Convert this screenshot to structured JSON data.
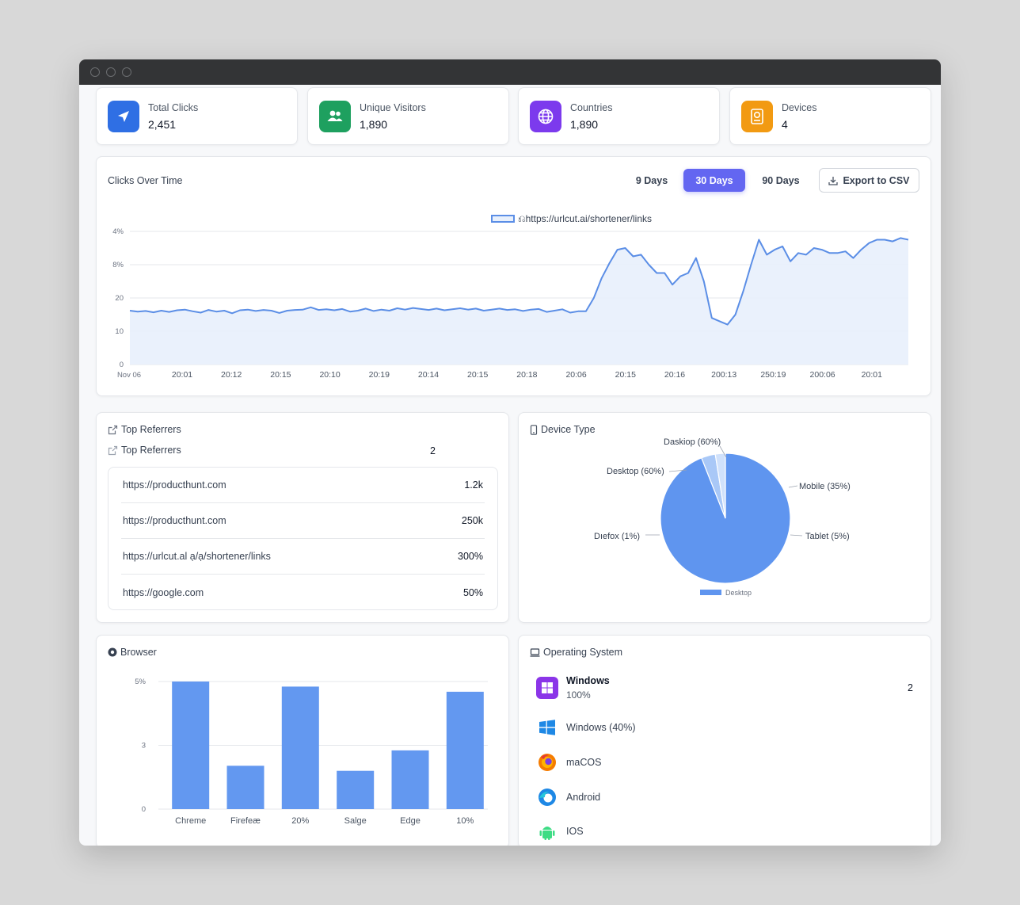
{
  "stats": [
    {
      "label": "Total Clicks",
      "value": "2,451",
      "icon": "send-icon",
      "color": "#2f6fe4"
    },
    {
      "label": "Unique Visitors",
      "value": "1,890",
      "icon": "users-icon",
      "color": "#1ea05f"
    },
    {
      "label": "Countries",
      "value": "1,890",
      "icon": "globe-icon",
      "color": "#7c3aed"
    },
    {
      "label": "Devices",
      "value": "4",
      "icon": "device-icon",
      "color": "#f29a12"
    }
  ],
  "clicks_chart": {
    "title": "Clicks Over Time",
    "ranges": [
      "9 Days",
      "30 Days",
      "90 Days"
    ],
    "active_range": "30 Days",
    "export_label": "Export to CSV",
    "legend": "⎌https://urlcut.ai/shortener/links",
    "accent": "#6366f1",
    "line_color": "#5b8ee6",
    "fill_color": "#e8f0fc"
  },
  "referrers": {
    "heading": "Top Referrers",
    "subheading": "Top Referrers",
    "count": "2",
    "rows": [
      {
        "url": "https://producthunt.com",
        "value": "1.2k"
      },
      {
        "url": "https://producthunt.com",
        "value": "250k"
      },
      {
        "url": "https://urlcut.al ạ/ạ/shortener/links",
        "value": "300%"
      },
      {
        "url": "https://google.com",
        "value": "50%"
      }
    ]
  },
  "device_type": {
    "title": "Device Type",
    "legend": "Desktop"
  },
  "browser": {
    "title": "Browser"
  },
  "os": {
    "title": "Operating System",
    "count": "2",
    "items": [
      {
        "label": "Windows",
        "sub": "100%",
        "icon": "windows-app-icon"
      },
      {
        "label": "Windows (40%)",
        "icon": "windows-logo-icon"
      },
      {
        "label": "maCOS",
        "icon": "firefox-icon"
      },
      {
        "label": "Android",
        "icon": "edge-icon"
      },
      {
        "label": "IOS",
        "icon": "android-icon"
      }
    ]
  },
  "chart_data": [
    {
      "type": "area",
      "title": "Clicks Over Time",
      "series": [
        {
          "name": "⎌https://urlcut.ai/shortener/links",
          "values": [
            16.2,
            15.9,
            16.1,
            15.7,
            16.2,
            15.8,
            16.3,
            16.5,
            16.0,
            15.6,
            16.4,
            15.9,
            16.2,
            15.4,
            16.3,
            16.5,
            16.1,
            16.4,
            16.2,
            15.5,
            16.2,
            16.4,
            16.5,
            17.2,
            16.4,
            16.6,
            16.3,
            16.7,
            15.9,
            16.2,
            16.8,
            16.1,
            16.5,
            16.2,
            16.9,
            16.5,
            17.0,
            16.7,
            16.4,
            16.8,
            16.3,
            16.6,
            16.9,
            16.5,
            16.8,
            16.2,
            16.5,
            16.8,
            16.4,
            16.6,
            16.1,
            16.5,
            16.7,
            15.8,
            16.2,
            16.6,
            15.6,
            16.0,
            16.0,
            20.0,
            26.0,
            30.5,
            34.5,
            35.0,
            32.5,
            33.0,
            30.0,
            27.5,
            27.5,
            24.0,
            26.5,
            27.5,
            32.0,
            25.0,
            14.0,
            13.0,
            12.0,
            15.0,
            22.0,
            30.0,
            37.5,
            33.0,
            34.5,
            35.5,
            31.0,
            33.5,
            33.0,
            35.0,
            34.5,
            33.5,
            33.5,
            34.0,
            32.0,
            34.5,
            36.5,
            37.5,
            37.5,
            37.0,
            38.0,
            37.5
          ]
        }
      ],
      "x_tick_labels": [
        "Nov 06",
        "20:01",
        "20:12",
        "20:15",
        "20:10",
        "20:19",
        "20:14",
        "20:15",
        "20:18",
        "20:06",
        "20:15",
        "20:16",
        "200:13",
        "250:19",
        "200:06",
        "20:01"
      ],
      "y_tick_labels": [
        "0",
        "10",
        "20",
        "8%",
        "4%"
      ],
      "ylim": [
        0,
        40
      ],
      "grid": true,
      "legend": "top-center"
    },
    {
      "type": "pie",
      "title": "Device Type",
      "slices": [
        {
          "label": "Desktop",
          "value": 94
        },
        {
          "label": "Desktop (60%)",
          "value": 3.5
        },
        {
          "label": "Daslop (60%)",
          "value": 2.5
        }
      ],
      "callouts": [
        "Daskiop (60%)",
        "Desktop (60%)",
        "Dıefox (1%)",
        "Mobile (35%)",
        "Tablet (5%)"
      ],
      "legend": "bottom"
    },
    {
      "type": "bar",
      "title": "Browser",
      "categories": [
        "Chreme",
        "Firefeæ",
        "20%",
        "Salge",
        "Edge",
        "10%"
      ],
      "values": [
        5.0,
        1.7,
        4.8,
        1.5,
        2.3,
        4.6
      ],
      "y_tick_labels": [
        "0",
        "3",
        "5%"
      ],
      "ylim": [
        0,
        5
      ],
      "grid": true
    }
  ]
}
